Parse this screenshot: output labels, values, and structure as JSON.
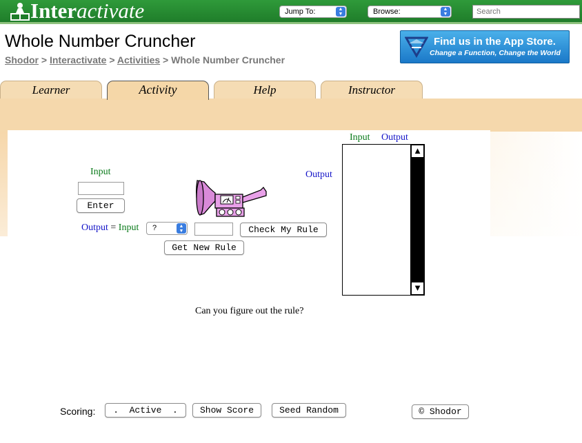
{
  "topbar": {
    "logo_part1": "Inter",
    "logo_part2": "activate",
    "jump_to": "Jump To:",
    "browse": "Browse:",
    "search_placeholder": "Search"
  },
  "header": {
    "title": "Whole Number Cruncher",
    "breadcrumb": {
      "shodor": "Shodor",
      "interactivate": "Interactivate",
      "activities": "Activities",
      "sep": ">",
      "current": "Whole Number Cruncher"
    },
    "banner": {
      "line1": "Find us in the App Store.",
      "line2": "Change a Function, Change the World"
    }
  },
  "tabs": [
    {
      "label": "Learner"
    },
    {
      "label": "Activity"
    },
    {
      "label": "Help"
    },
    {
      "label": "Instructor"
    }
  ],
  "applet": {
    "input_label": "Input",
    "enter_label": "Enter",
    "output_label": "Output",
    "rule_output": "Output",
    "rule_equals": "=",
    "rule_input": "Input",
    "operator_selected": "?",
    "check_rule_label": "Check My Rule",
    "new_rule_label": "Get New Rule",
    "table_input": "Input",
    "table_output": "Output",
    "scroll_up": "▲",
    "scroll_down": "▼",
    "prompt": "Can you figure out the rule?"
  },
  "footer": {
    "scoring_label": "Scoring:",
    "active_label": ".  Active  .",
    "show_score_label": "Show Score",
    "seed_random_label": "Seed Random",
    "shodor_label": "© Shodor"
  },
  "colors": {
    "topbar": "#1f7d2a",
    "tab": "#f5dcb4",
    "input_text": "#0a7a1a",
    "output_text": "#1414c8",
    "banner": "#1a78c8"
  }
}
